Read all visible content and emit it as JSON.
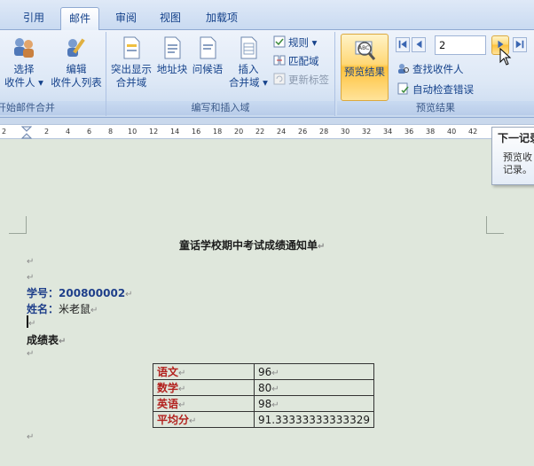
{
  "tabs": [
    {
      "label": "引用"
    },
    {
      "label": "邮件"
    },
    {
      "label": "审阅"
    },
    {
      "label": "视图"
    },
    {
      "label": "加载项"
    }
  ],
  "ribbon": {
    "group_start": {
      "label": "开始邮件合并",
      "select_recipients": [
        "选择",
        "收件人 ▾"
      ],
      "edit_recipients": [
        "编辑",
        "收件人列表"
      ]
    },
    "group_write": {
      "label": "编写和插入域",
      "highlight_fields": [
        "突出显示",
        "合并域"
      ],
      "address_block": "地址块",
      "greeting_line": "问候语",
      "insert_field": [
        "插入",
        "合并域 ▾"
      ],
      "rules": "规则 ▾",
      "match_fields": "匹配域",
      "update_labels": "更新标签"
    },
    "group_preview": {
      "label": "预览结果",
      "preview_results": "预览结果",
      "record_number": "2",
      "find_recipient": "查找收件人",
      "auto_check": "自动检查错误"
    },
    "colors": {
      "preview_highlight": "#ffc23b"
    }
  },
  "ruler": {
    "numbers": [
      "2",
      "2",
      "4",
      "6",
      "8",
      "10",
      "12",
      "14",
      "16",
      "18",
      "20",
      "22",
      "24",
      "26",
      "28",
      "30",
      "32",
      "34",
      "36",
      "38",
      "40",
      "42"
    ]
  },
  "tooltip": {
    "title": "下一记录",
    "body": [
      "预览收",
      "记录。"
    ]
  },
  "document": {
    "title": "童话学校期中考试成绩通知单",
    "student_id_label": "学号：",
    "student_id_value": "200800002",
    "name_label": "姓名：",
    "name_value": "米老鼠",
    "scores_heading": "成绩表",
    "para_mark": "↵",
    "scores": [
      {
        "subject": "语文",
        "score": "96"
      },
      {
        "subject": "数学",
        "score": "80"
      },
      {
        "subject": "英语",
        "score": "98"
      },
      {
        "subject": "平均分",
        "score": "91.33333333333329"
      }
    ]
  }
}
